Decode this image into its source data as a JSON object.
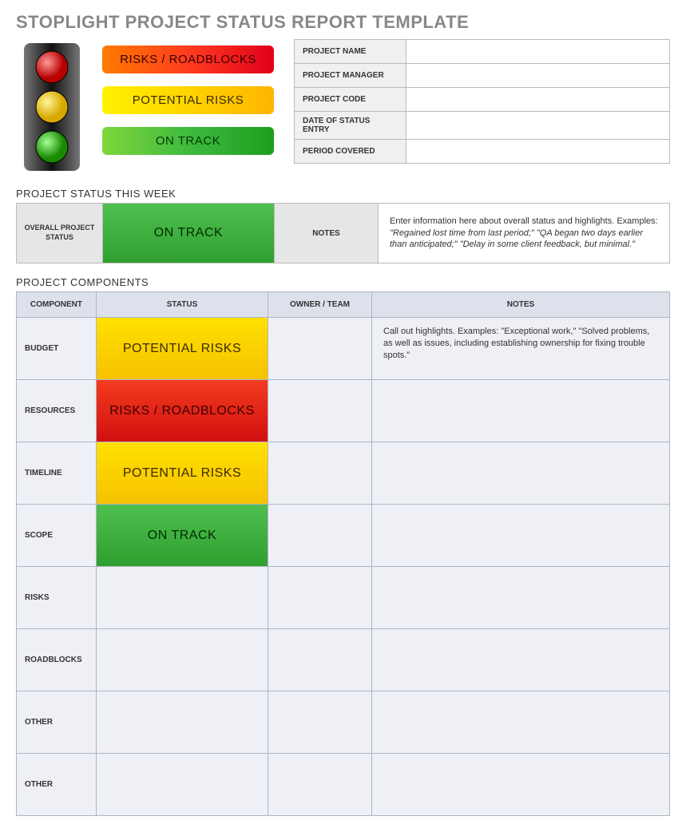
{
  "title": "STOPLIGHT PROJECT STATUS REPORT TEMPLATE",
  "legend": {
    "red": "RISKS / ROADBLOCKS",
    "yellow": "POTENTIAL RISKS",
    "green": "ON TRACK"
  },
  "info_labels": {
    "project_name": "PROJECT NAME",
    "project_manager": "PROJECT MANAGER",
    "project_code": "PROJECT CODE",
    "date_of_status_entry": "DATE OF STATUS ENTRY",
    "period_covered": "PERIOD COVERED"
  },
  "info_values": {
    "project_name": "",
    "project_manager": "",
    "project_code": "",
    "date_of_status_entry": "",
    "period_covered": ""
  },
  "status_this_week": {
    "section": "PROJECT STATUS THIS WEEK",
    "overall_label": "OVERALL PROJECT STATUS",
    "overall_value": "ON TRACK",
    "overall_style": "bg-green",
    "notes_label": "NOTES",
    "notes_plain": "Enter information here about overall status and highlights. Examples: ",
    "notes_italic": "\"Regained lost time from last period;\" \"QA began two days earlier than anticipated;\" \"Delay in some client feedback, but minimal.\""
  },
  "components": {
    "section": "PROJECT COMPONENTS",
    "headers": {
      "component": "COMPONENT",
      "status": "STATUS",
      "owner": "OWNER / TEAM",
      "notes": "NOTES"
    },
    "rows": [
      {
        "label": "BUDGET",
        "status": "POTENTIAL RISKS",
        "style": "bg-yellow",
        "owner": "",
        "notes": "Call out highlights. Examples: \"Exceptional work,\" \"Solved problems, as well as issues, including establishing ownership for fixing trouble spots.\""
      },
      {
        "label": "RESOURCES",
        "status": "RISKS / ROADBLOCKS",
        "style": "bg-red",
        "owner": "",
        "notes": ""
      },
      {
        "label": "TIMELINE",
        "status": "POTENTIAL RISKS",
        "style": "bg-yellow",
        "owner": "",
        "notes": ""
      },
      {
        "label": "SCOPE",
        "status": "ON TRACK",
        "style": "bg-green",
        "owner": "",
        "notes": ""
      },
      {
        "label": "RISKS",
        "status": "",
        "style": "",
        "owner": "",
        "notes": ""
      },
      {
        "label": "ROADBLOCKS",
        "status": "",
        "style": "",
        "owner": "",
        "notes": ""
      },
      {
        "label": "OTHER",
        "status": "",
        "style": "",
        "owner": "",
        "notes": ""
      },
      {
        "label": "OTHER",
        "status": "",
        "style": "",
        "owner": "",
        "notes": ""
      }
    ]
  }
}
